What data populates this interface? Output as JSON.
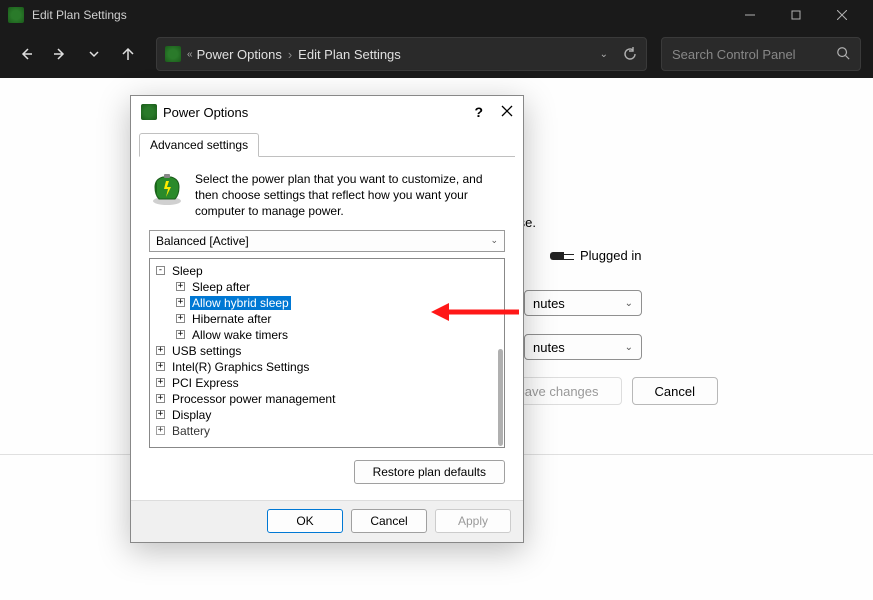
{
  "window": {
    "title": "Edit Plan Settings"
  },
  "breadcrumb": {
    "item1": "Power Options",
    "item2": "Edit Plan Settings"
  },
  "search": {
    "placeholder": "Search Control Panel"
  },
  "background": {
    "se_fragment": "se.",
    "plugged_in": "Plugged in",
    "dropdown1_text": "nutes",
    "dropdown2_text": "nutes",
    "save_changes": "Save changes",
    "cancel": "Cancel"
  },
  "dialog": {
    "title": "Power Options",
    "tab": "Advanced settings",
    "info_text": "Select the power plan that you want to customize, and then choose settings that reflect how you want your computer to manage power.",
    "plan": "Balanced [Active]",
    "tree": {
      "sleep": "Sleep",
      "sleep_after": "Sleep after",
      "allow_hybrid": "Allow hybrid sleep",
      "hibernate_after": "Hibernate after",
      "allow_wake": "Allow wake timers",
      "usb": "USB settings",
      "intel_gfx": "Intel(R) Graphics Settings",
      "pci": "PCI Express",
      "proc": "Processor power management",
      "display": "Display",
      "battery": "Battery"
    },
    "restore": "Restore plan defaults",
    "ok": "OK",
    "cancel": "Cancel",
    "apply": "Apply"
  }
}
